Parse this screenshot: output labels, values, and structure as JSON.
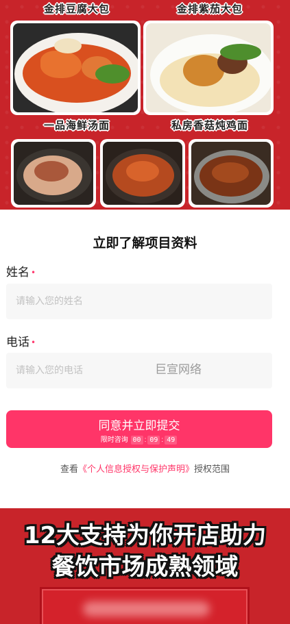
{
  "banner": {
    "dishes_top": [
      {
        "label": "金排豆腐大包"
      },
      {
        "label": "金排紫茄大包"
      }
    ],
    "dishes_mid": [
      {
        "label": "一品海鲜汤面"
      },
      {
        "label": "私房香菇炖鸡面"
      }
    ]
  },
  "form": {
    "title": "立即了解项目资料",
    "name": {
      "label": "姓名",
      "required_mark": "•",
      "placeholder": "请输入您的姓名",
      "value": ""
    },
    "phone": {
      "label": "电话",
      "required_mark": "•",
      "placeholder": "请输入您的电话",
      "value": ""
    },
    "watermark": "巨宣网络",
    "submit_label": "同意并立即提交",
    "countdown": {
      "prefix": "限时咨询",
      "hours": "00",
      "minutes": "09",
      "seconds": "49"
    },
    "consent": {
      "before": "查看",
      "link": "《个人信息授权与保护声明》",
      "after": "授权范围"
    }
  },
  "bottom_banner": {
    "line1": "12大支持为你开店助力",
    "line2": "餐饮市场成熟领域"
  }
}
